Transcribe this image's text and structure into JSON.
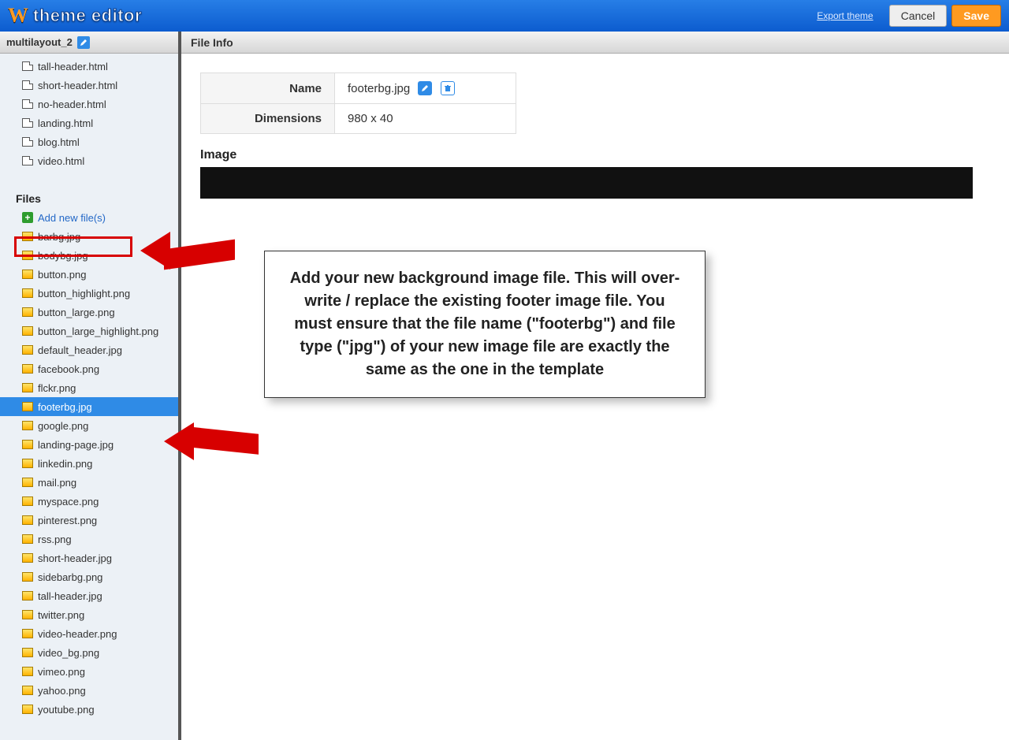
{
  "topbar": {
    "brand_text": "theme editor",
    "export_label": "Export theme",
    "cancel_label": "Cancel",
    "save_label": "Save"
  },
  "sidebar": {
    "theme_name": "multilayout_2",
    "pages": [
      "tall-header.html",
      "short-header.html",
      "no-header.html",
      "landing.html",
      "blog.html",
      "video.html"
    ],
    "files_section_label": "Files",
    "add_files_label": "Add new file(s)",
    "files": [
      "barbg.jpg",
      "bodybg.jpg",
      "button.png",
      "button_highlight.png",
      "button_large.png",
      "button_large_highlight.png",
      "default_header.jpg",
      "facebook.png",
      "flckr.png",
      "footerbg.jpg",
      "google.png",
      "landing-page.jpg",
      "linkedin.png",
      "mail.png",
      "myspace.png",
      "pinterest.png",
      "rss.png",
      "short-header.jpg",
      "sidebarbg.png",
      "tall-header.jpg",
      "twitter.png",
      "video-header.png",
      "video_bg.png",
      "vimeo.png",
      "yahoo.png",
      "youtube.png"
    ],
    "selected_file": "footerbg.jpg"
  },
  "main": {
    "panel_title": "File Info",
    "name_label": "Name",
    "name_value": "footerbg.jpg",
    "dims_label": "Dimensions",
    "dims_value": "980 x 40",
    "image_label": "Image"
  },
  "callout": {
    "text": "Add your new background image file.  This will over-write / replace the existing footer image file.  You must ensure that the file name (\"footerbg\") and file type (\"jpg\") of your new image file are exactly the same as the one in the template"
  }
}
